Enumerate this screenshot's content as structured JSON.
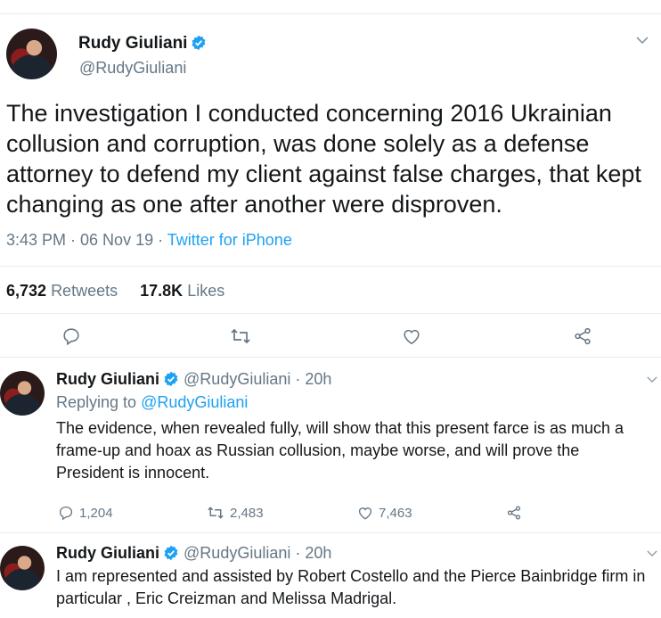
{
  "main_tweet": {
    "name": "Rudy Giuliani",
    "handle": "@RudyGiuliani",
    "text": "The investigation I conducted concerning 2016 Ukrainian collusion and corruption, was done solely as a defense attorney to defend my client against false charges, that kept changing as one after another were disproven.",
    "time": "3:43 PM · 06 Nov 19 · ",
    "source": "Twitter for iPhone",
    "retweets_count": "6,732",
    "retweets_label": "Retweets",
    "likes_count": "17.8K",
    "likes_label": "Likes"
  },
  "replies": [
    {
      "name": "Rudy Giuliani",
      "handle": "@RudyGiuliani",
      "age": "· 20h",
      "replying_prefix": "Replying to ",
      "replying_to": "@RudyGiuliani",
      "text": "The evidence, when revealed fully, will show that this present farce is as much a frame-up and hoax as Russian collusion, maybe worse, and will prove the President is innocent.",
      "reply_count": "1,204",
      "retweet_count": "2,483",
      "like_count": "7,463"
    },
    {
      "name": "Rudy Giuliani",
      "handle": "@RudyGiuliani",
      "age": "· 20h",
      "text": "I am represented and assisted by Robert Costello and the Pierce Bainbridge firm in particular , Eric Creizman and Melissa Madrigal."
    }
  ],
  "colors": {
    "accent": "#1da1f2",
    "muted": "#657786",
    "text": "#14171a",
    "divider": "#e6ecf0"
  },
  "icons": [
    "verified-badge-icon",
    "chevron-down-icon",
    "reply-icon",
    "retweet-icon",
    "like-icon",
    "share-icon"
  ]
}
